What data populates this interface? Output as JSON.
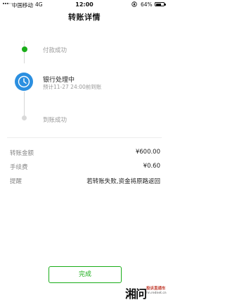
{
  "status_bar": {
    "carrier": "中国移动",
    "network": "4G",
    "time": "12:00",
    "battery_percent": "64%",
    "battery_level": 0.64
  },
  "page": {
    "title": "转账详情"
  },
  "timeline": {
    "steps": [
      {
        "label": "付款成功",
        "state": "done",
        "icon": "check-dot-icon"
      },
      {
        "label": "银行处理中",
        "sub": "预计11-27 24:00前到账",
        "state": "current",
        "icon": "clock-icon"
      },
      {
        "label": "到账成功",
        "state": "pending",
        "icon": "pending-dot-icon"
      }
    ]
  },
  "details": {
    "rows": [
      {
        "label": "转账金额",
        "value": "¥600.00"
      },
      {
        "label": "手续费",
        "value": "¥0.60"
      },
      {
        "label": "提醒",
        "value": "若转账失败,资金将原路返回"
      }
    ]
  },
  "footer": {
    "done_label": "完成"
  },
  "watermark": {
    "mark": "湘问",
    "name": "投诉直通车",
    "url": "hn.rednet.cn"
  },
  "colors": {
    "accent_green": "#1aad19",
    "clock_blue": "#2b8fe0",
    "muted_text": "#9a9a9a"
  }
}
